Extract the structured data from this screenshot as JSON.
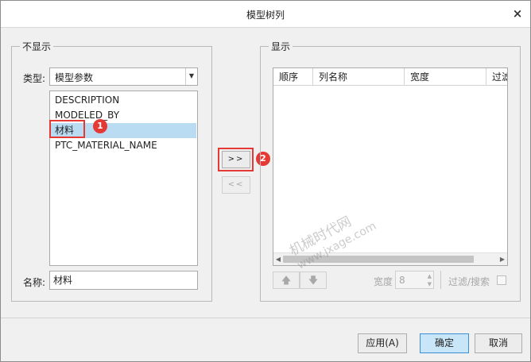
{
  "window": {
    "title": "模型树列",
    "close_glyph": "×"
  },
  "left_panel": {
    "group_label": "不显示",
    "type_label": "类型:",
    "type_value": "模型参数",
    "items": [
      "DESCRIPTION",
      "MODELED_BY",
      "材料",
      "PTC_MATERIAL_NAME"
    ],
    "selected_index": 2,
    "name_label": "名称:",
    "name_value": "材料"
  },
  "transfer": {
    "add_label": ">>",
    "remove_label": "<<"
  },
  "right_panel": {
    "group_label": "显示",
    "columns": [
      "顺序",
      "列名称",
      "宽度",
      "过滤"
    ],
    "width_label": "宽度",
    "width_value": "8",
    "filter_label": "过滤/搜索"
  },
  "annotations": {
    "step1": "1",
    "step2": "2"
  },
  "watermark": {
    "line1": "机械时代网",
    "line2": "www.jxage.com"
  },
  "footer": {
    "apply_label": "应用(A)",
    "ok_label": "确定",
    "cancel_label": "取消"
  },
  "colors": {
    "selection": "#b9dcf3",
    "annotation": "#e53935",
    "primary_button": "#c9e5f8"
  },
  "icons": [
    "close-icon",
    "dropdown-arrow-icon",
    "move-up-icon",
    "move-down-icon",
    "scroll-left-icon",
    "scroll-right-icon"
  ]
}
